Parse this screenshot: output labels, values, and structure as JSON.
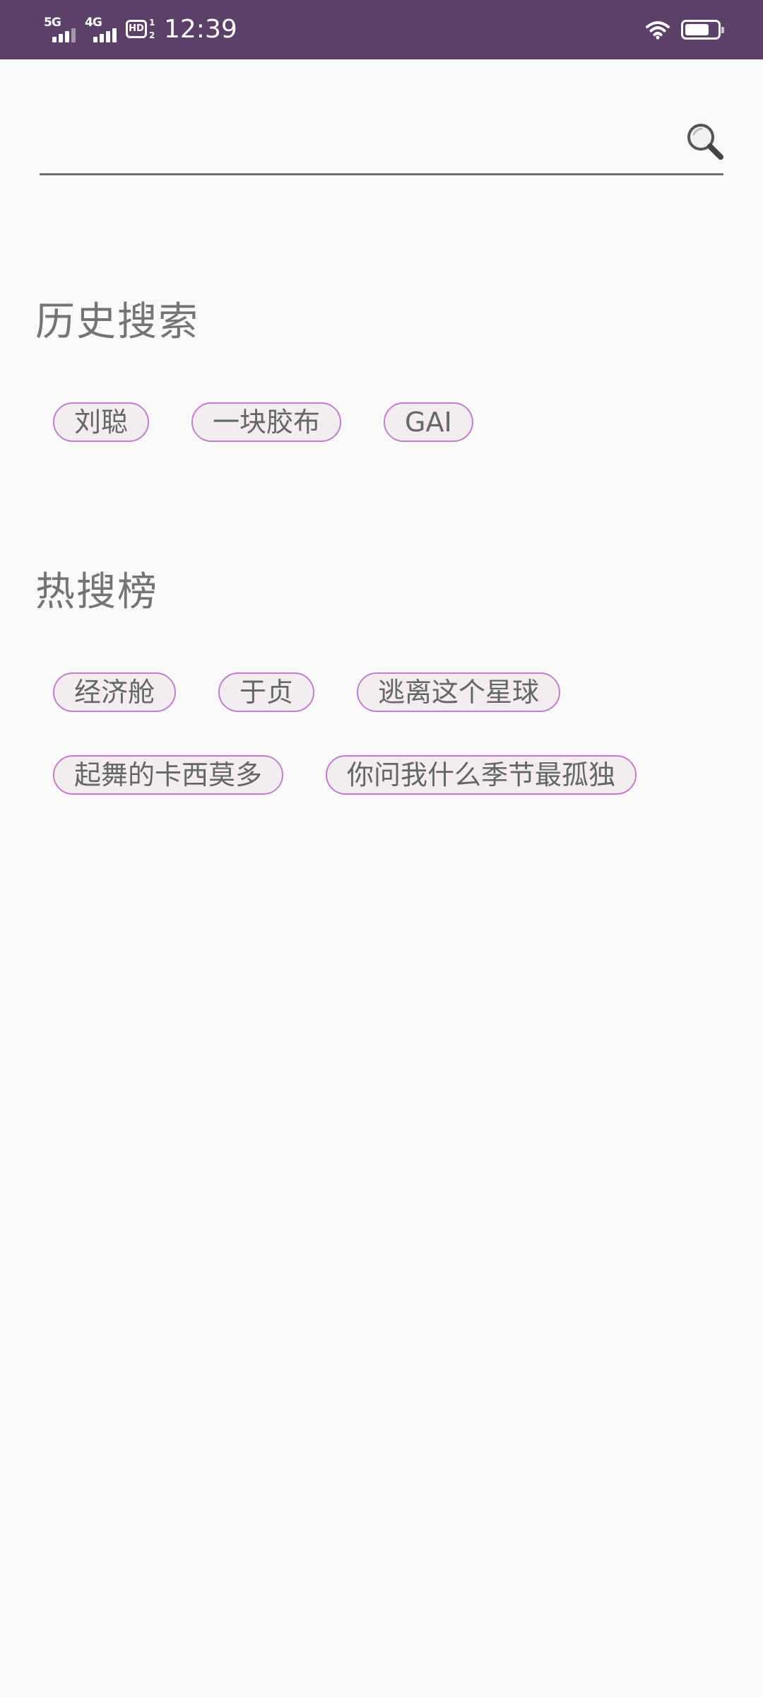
{
  "status_bar": {
    "network_1": "5G",
    "network_2": "4G",
    "hd_label": "HD",
    "hd_top": "1",
    "hd_bottom": "2",
    "time": "12:39",
    "battery_level": 0.65,
    "background_color": "#5b4068"
  },
  "search": {
    "value": "",
    "placeholder": "",
    "icon": "search-icon"
  },
  "history": {
    "title": "历史搜索",
    "items": [
      "刘聪",
      "一块胶布",
      "GAI"
    ]
  },
  "hot": {
    "title": "热搜榜",
    "rows": [
      [
        "经济舱",
        "于贞",
        "逃离这个星球"
      ],
      [
        "起舞的卡西莫多",
        "你问我什么季节最孤独"
      ]
    ]
  },
  "colors": {
    "chip_border": "#c17ed0",
    "chip_background": "#f3eeee",
    "text_gray": "#747474",
    "page_background": "#fafafa"
  }
}
